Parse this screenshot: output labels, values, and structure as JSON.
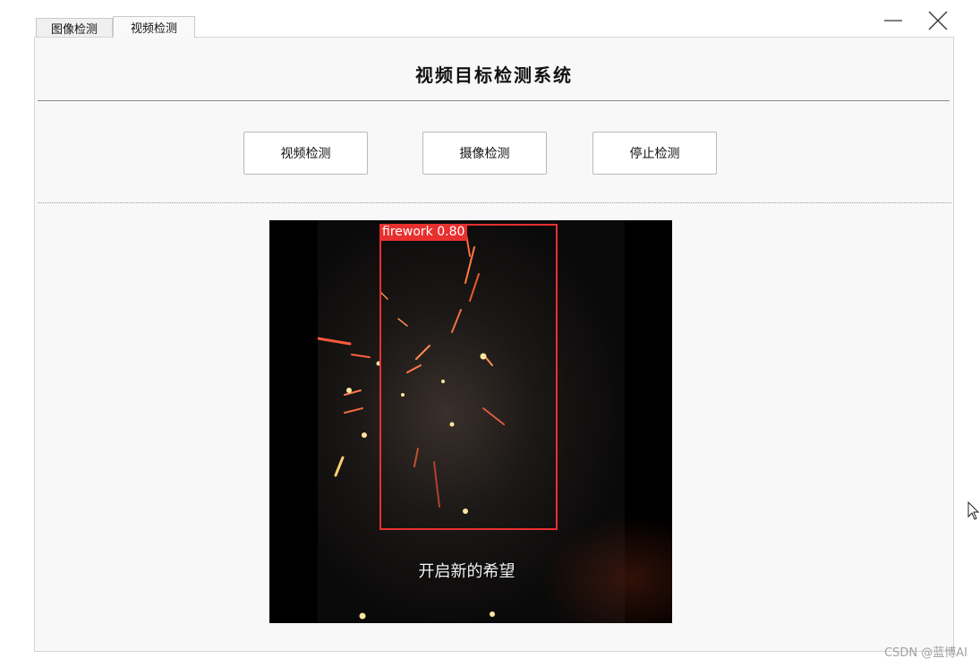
{
  "tabs": [
    {
      "label": "图像检测",
      "active": false
    },
    {
      "label": "视频检测",
      "active": true
    }
  ],
  "window_controls": {
    "minimize_icon": "minimize-icon",
    "close_icon": "close-icon"
  },
  "header": {
    "title": "视频目标检测系统"
  },
  "buttons": {
    "video_detect": "视频检测",
    "camera_detect": "摄像检测",
    "stop_detect": "停止检测"
  },
  "video": {
    "detection_label": "firework  0.80",
    "subtitle": "开启新的希望"
  },
  "watermark": "CSDN @蓝博AI",
  "colors": {
    "bbox": "#e8302f",
    "panel_bg": "#f8f8f8",
    "accent_line": "#8a8a8a"
  }
}
